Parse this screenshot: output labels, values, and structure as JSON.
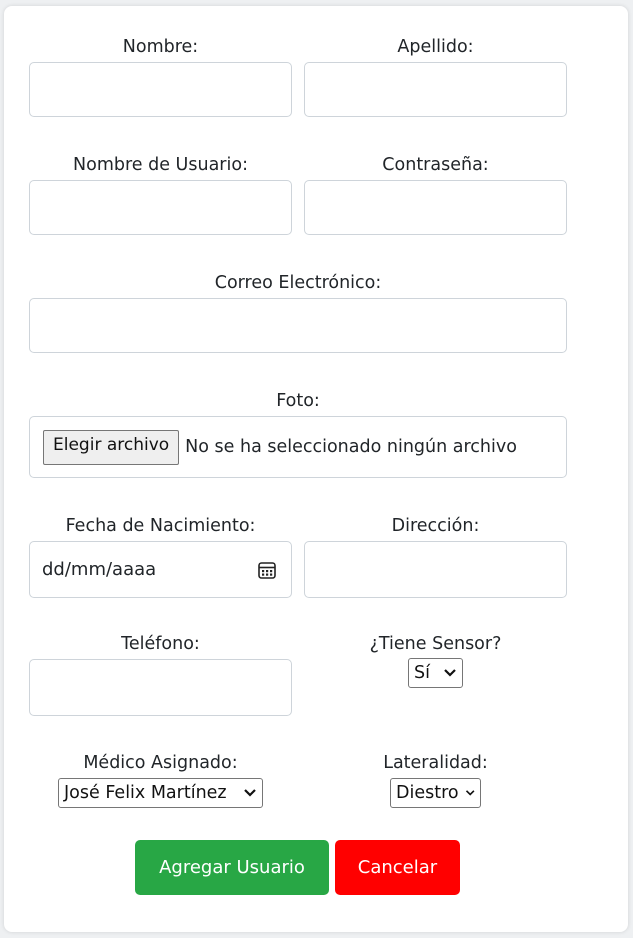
{
  "form": {
    "nombre_label": "Nombre:",
    "apellido_label": "Apellido:",
    "usuario_label": "Nombre de Usuario:",
    "contrasena_label": "Contraseña:",
    "correo_label": "Correo Electrónico:",
    "foto_label": "Foto:",
    "foto_button": "Elegir archivo",
    "foto_status": "No se ha seleccionado ningún archivo",
    "fecha_label": "Fecha de Nacimiento:",
    "fecha_placeholder": "dd/mm/aaaa",
    "direccion_label": "Dirección:",
    "telefono_label": "Teléfono:",
    "sensor_label": "¿Tiene Sensor?",
    "sensor_value": "Sí",
    "medico_label": "Médico Asignado:",
    "medico_value": "José Felix Martínez",
    "lateralidad_label": "Lateralidad:",
    "lateralidad_value": "Diestro"
  },
  "actions": {
    "add_label": "Agregar Usuario",
    "cancel_label": "Cancelar"
  },
  "colors": {
    "add_button": "#28a745",
    "cancel_button": "#ff0000"
  },
  "icons": {
    "date": "calendar-icon",
    "select": "chevron-down-icon"
  }
}
